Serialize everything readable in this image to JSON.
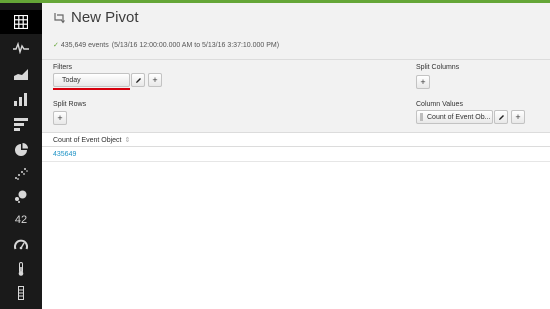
{
  "page": {
    "title": "New Pivot"
  },
  "summary": {
    "count_text": "435,649 events",
    "range_text": "(5/13/16 12:00:00.000 AM to 5/13/16 3:37:10.000 PM)"
  },
  "sidebar": {
    "items": [
      {
        "name": "statistics-table-icon"
      },
      {
        "name": "line-chart-icon"
      },
      {
        "name": "area-chart-icon"
      },
      {
        "name": "column-chart-icon"
      },
      {
        "name": "bar-chart-icon"
      },
      {
        "name": "pie-chart-icon"
      },
      {
        "name": "scatter-chart-icon"
      },
      {
        "name": "bubble-chart-icon"
      },
      {
        "name": "single-value-icon",
        "label": "42"
      },
      {
        "name": "radial-gauge-icon"
      },
      {
        "name": "filler-gauge-icon"
      },
      {
        "name": "marker-gauge-icon"
      }
    ]
  },
  "filters": {
    "label": "Filters",
    "items": [
      {
        "label": "Today"
      }
    ],
    "edit_icon": "pencil-icon",
    "add_label": "+"
  },
  "split_rows": {
    "label": "Split Rows",
    "add_label": "+"
  },
  "split_columns": {
    "label": "Split Columns",
    "add_label": "+"
  },
  "column_values": {
    "label": "Column Values",
    "items": [
      {
        "label": "Count of Event Ob..."
      }
    ],
    "edit_icon": "pencil-icon",
    "add_label": "+"
  },
  "table": {
    "columns": [
      {
        "label": "Count of Event Object",
        "sort_icon": "⇕"
      }
    ],
    "rows": [
      {
        "cells": [
          "435649"
        ]
      }
    ]
  },
  "colors": {
    "accent_green": "#65a637",
    "highlight_red": "#d6000d",
    "link_blue": "#1e93c6"
  }
}
